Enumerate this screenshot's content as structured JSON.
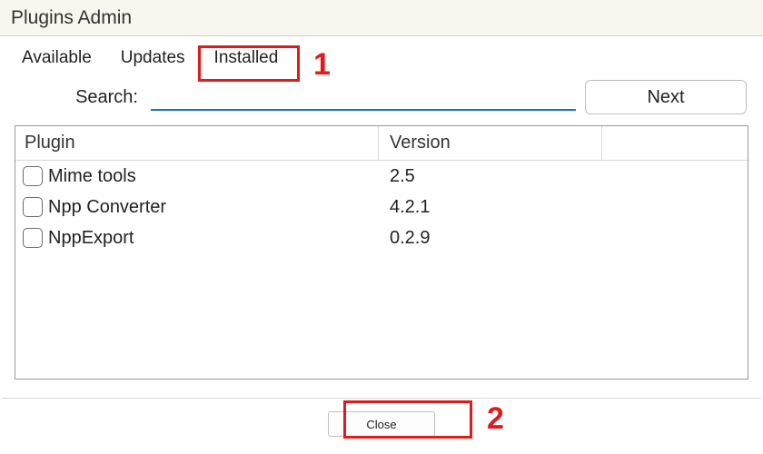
{
  "window": {
    "title": "Plugins Admin"
  },
  "tabs": {
    "available": "Available",
    "updates": "Updates",
    "installed": "Installed"
  },
  "search": {
    "label": "Search:",
    "value": "",
    "next": "Next"
  },
  "columns": {
    "plugin": "Plugin",
    "version": "Version"
  },
  "plugins": [
    {
      "name": "Mime tools",
      "version": "2.5"
    },
    {
      "name": "Npp Converter",
      "version": "4.2.1"
    },
    {
      "name": "NppExport",
      "version": "0.2.9"
    }
  ],
  "buttons": {
    "close": "Close"
  },
  "annotations": {
    "one": "1",
    "two": "2"
  }
}
